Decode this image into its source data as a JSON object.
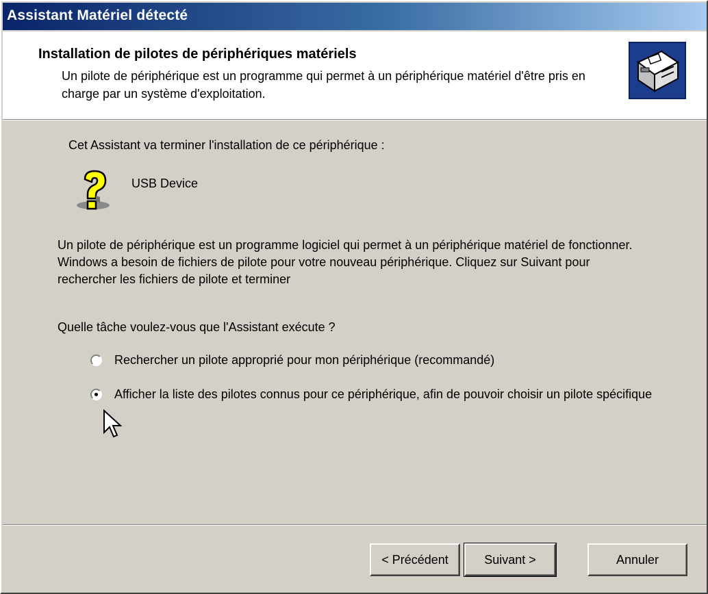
{
  "window": {
    "title": "Assistant Matériel détecté"
  },
  "header": {
    "title": "Installation de pilotes de périphériques matériels",
    "description": "Un pilote de périphérique est un programme qui permet à un périphérique matériel d'être pris en charge par un système d'exploitation.",
    "icon": "hardware-installer-icon"
  },
  "body": {
    "intro": "Cet Assistant va terminer l'installation de ce périphérique :",
    "device": {
      "name": "USB Device",
      "icon": "unknown-device-question-icon"
    },
    "paragraph": "Un pilote de périphérique est un programme logiciel qui permet à un périphérique matériel de fonctionner. Windows a besoin de fichiers de pilote pour votre nouveau périphérique. Cliquez sur Suivant pour rechercher les fichiers de pilote et terminer",
    "question": "Quelle tâche voulez-vous que l'Assistant exécute ?",
    "options": [
      {
        "label": "Rechercher un pilote approprié pour mon périphérique (recommandé)",
        "checked": false
      },
      {
        "label": "Afficher la liste des pilotes connus pour ce périphérique, afin de pouvoir choisir un pilote spécifique",
        "checked": true
      }
    ]
  },
  "buttons": {
    "back": "< Précédent",
    "next": "Suivant >",
    "cancel": "Annuler"
  },
  "colors": {
    "title_gradient_start": "#0a246a",
    "title_gradient_end": "#a6caf0",
    "face": "#d4d0c8",
    "header_bg": "#ffffff"
  }
}
